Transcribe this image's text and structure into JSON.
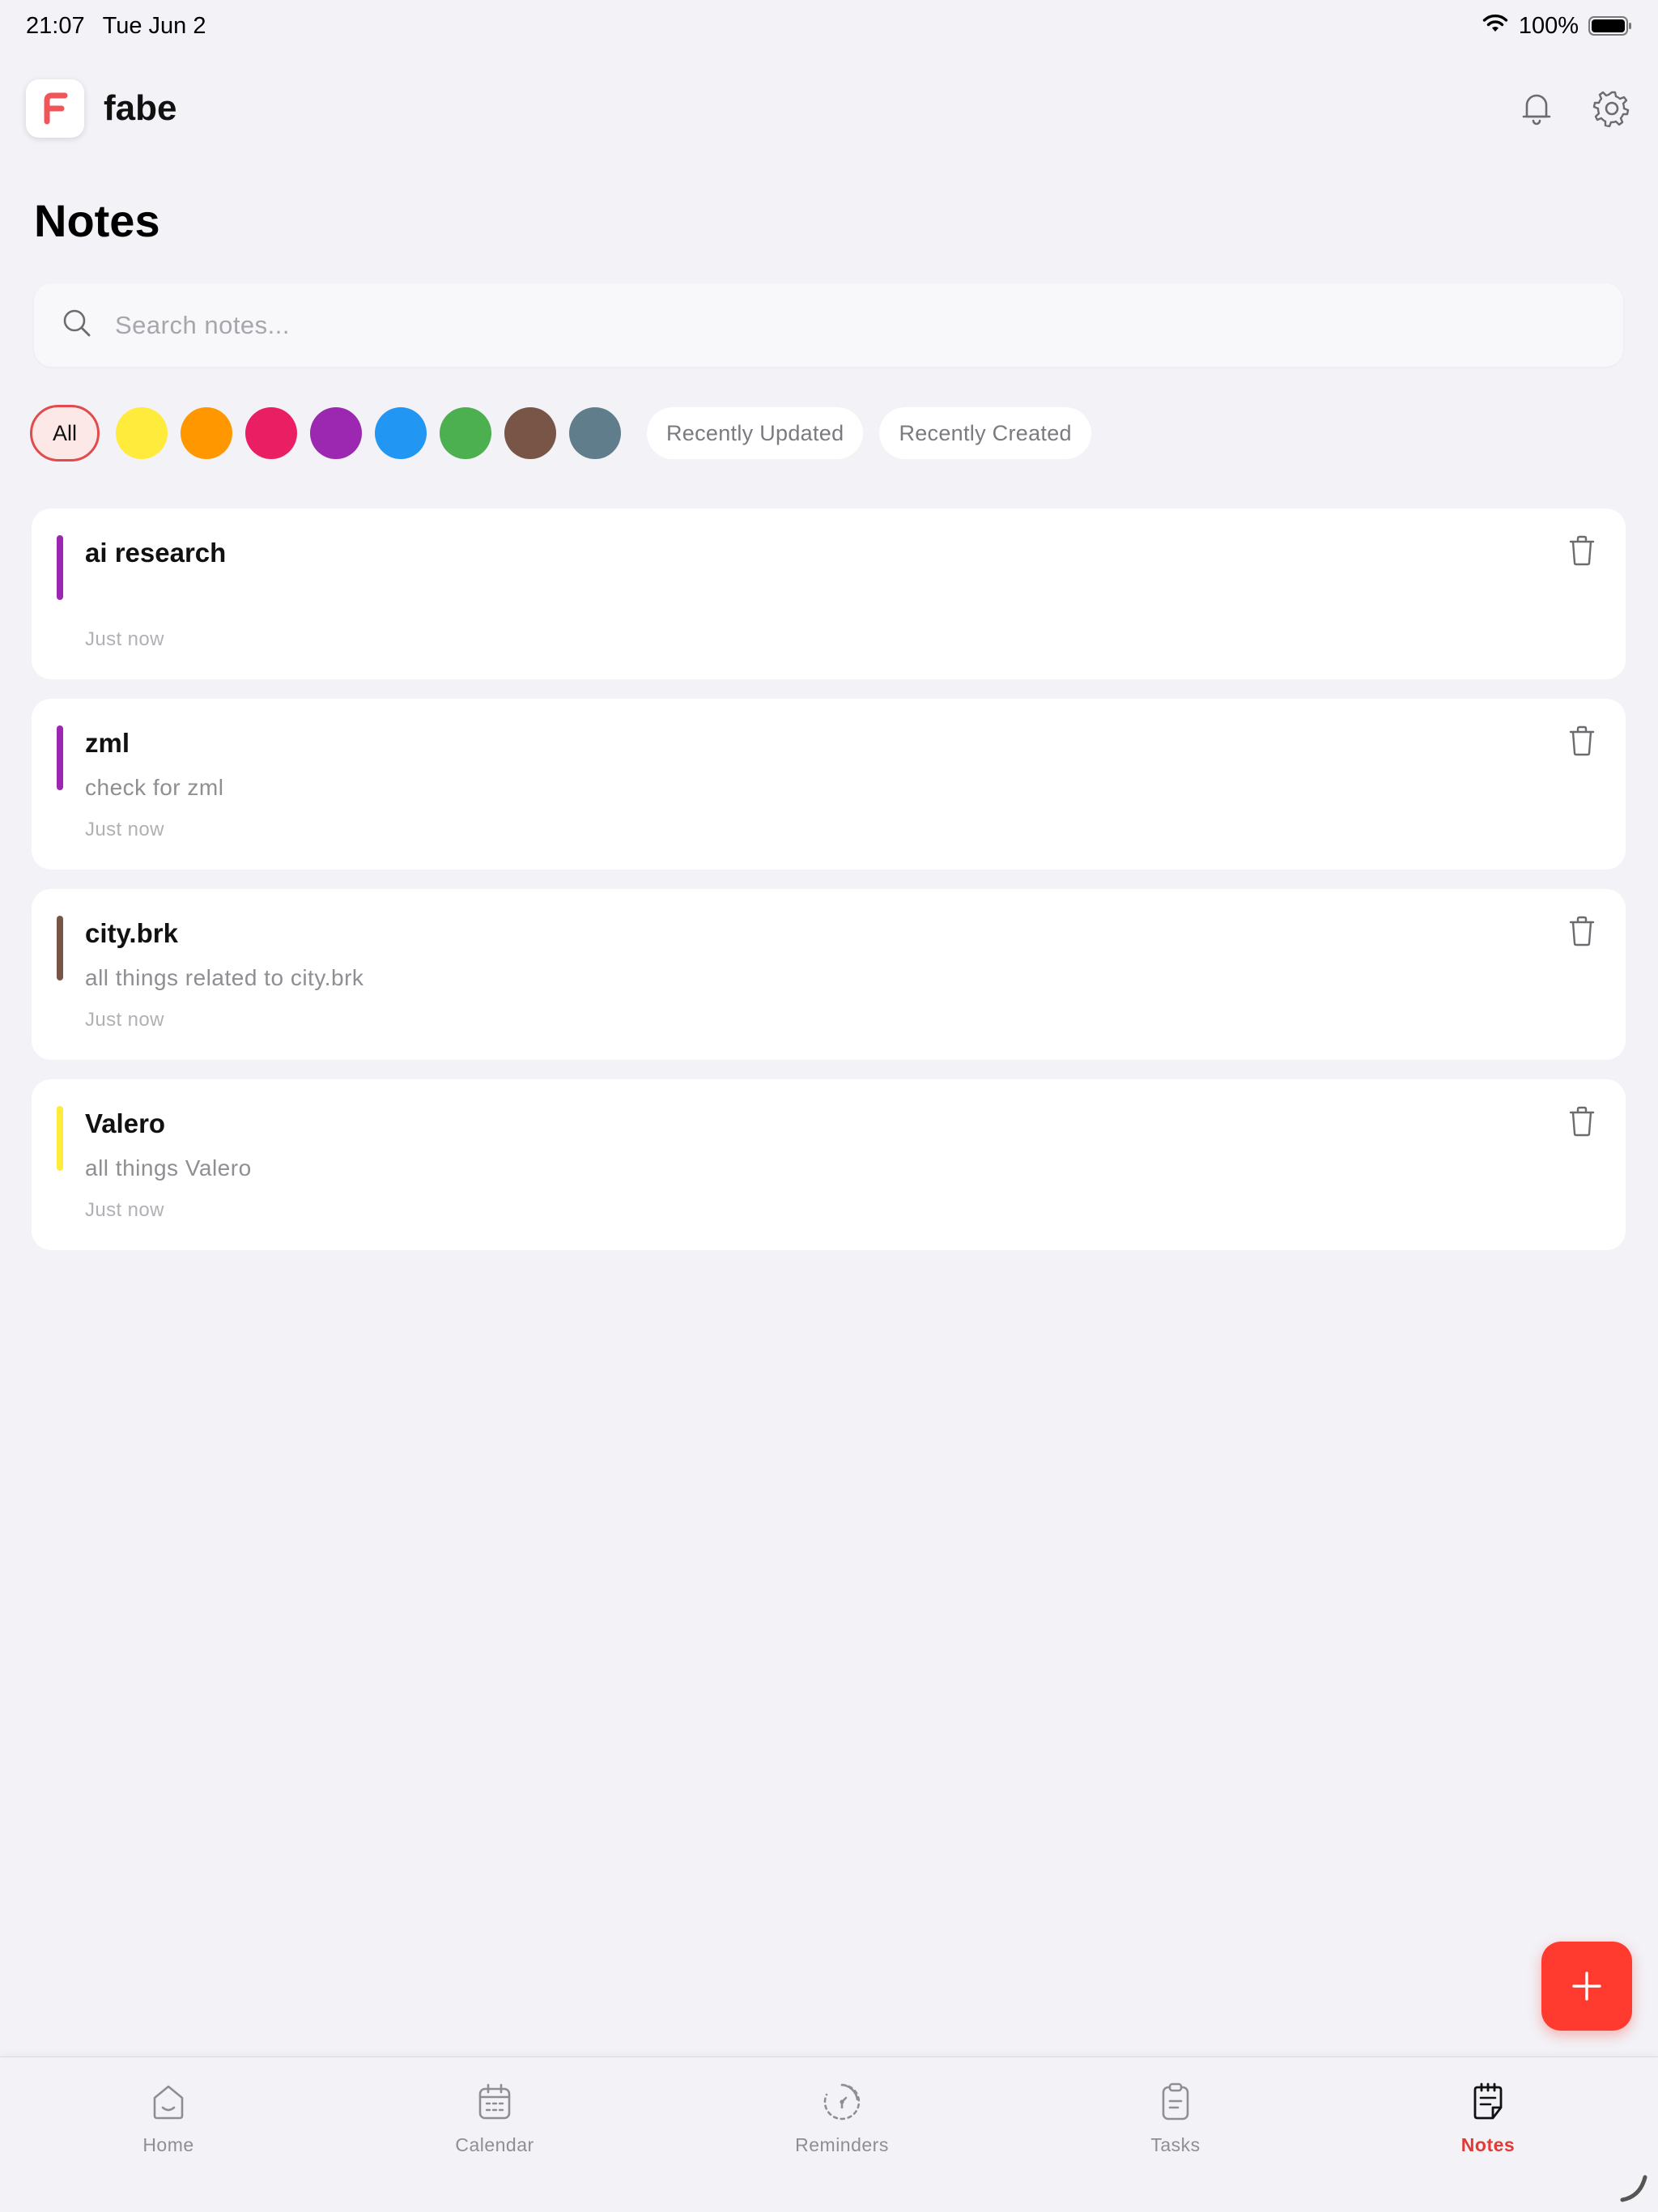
{
  "status_bar": {
    "time": "21:07",
    "date": "Tue Jun 2",
    "battery": "100%",
    "icons": [
      "wifi-icon",
      "battery-icon"
    ]
  },
  "header": {
    "app_name": "fabe",
    "logo_letter": "F",
    "icons": [
      "bell-icon",
      "gear-icon"
    ]
  },
  "page": {
    "title": "Notes"
  },
  "search": {
    "placeholder": "Search notes...",
    "value": ""
  },
  "filters": {
    "all_label": "All",
    "colors": [
      "#ffeb3b",
      "#ff9800",
      "#e91e63",
      "#9c27b0",
      "#2196f3",
      "#4caf50",
      "#795548",
      "#607d8b"
    ],
    "sort_options": [
      "Recently Updated",
      "Recently Created"
    ]
  },
  "notes": [
    {
      "title": "ai research",
      "description": "",
      "time": "Just now",
      "color": "#9c27b0"
    },
    {
      "title": "zml",
      "description": "check for zml",
      "time": "Just now",
      "color": "#9c27b0"
    },
    {
      "title": "city.brk",
      "description": "all things related to city.brk",
      "time": "Just now",
      "color": "#795548"
    },
    {
      "title": "Valero",
      "description": "all things Valero",
      "time": "Just now",
      "color": "#ffeb3b"
    }
  ],
  "tabs": [
    {
      "label": "Home",
      "icon": "home-icon",
      "active": false
    },
    {
      "label": "Calendar",
      "icon": "calendar-icon",
      "active": false
    },
    {
      "label": "Reminders",
      "icon": "reminder-icon",
      "active": false
    },
    {
      "label": "Tasks",
      "icon": "clipboard-icon",
      "active": false
    },
    {
      "label": "Notes",
      "icon": "notes-icon",
      "active": true
    }
  ],
  "colors": {
    "accent": "#ff3b30",
    "active_tab": "#e53935",
    "background": "#f2f2f7"
  }
}
